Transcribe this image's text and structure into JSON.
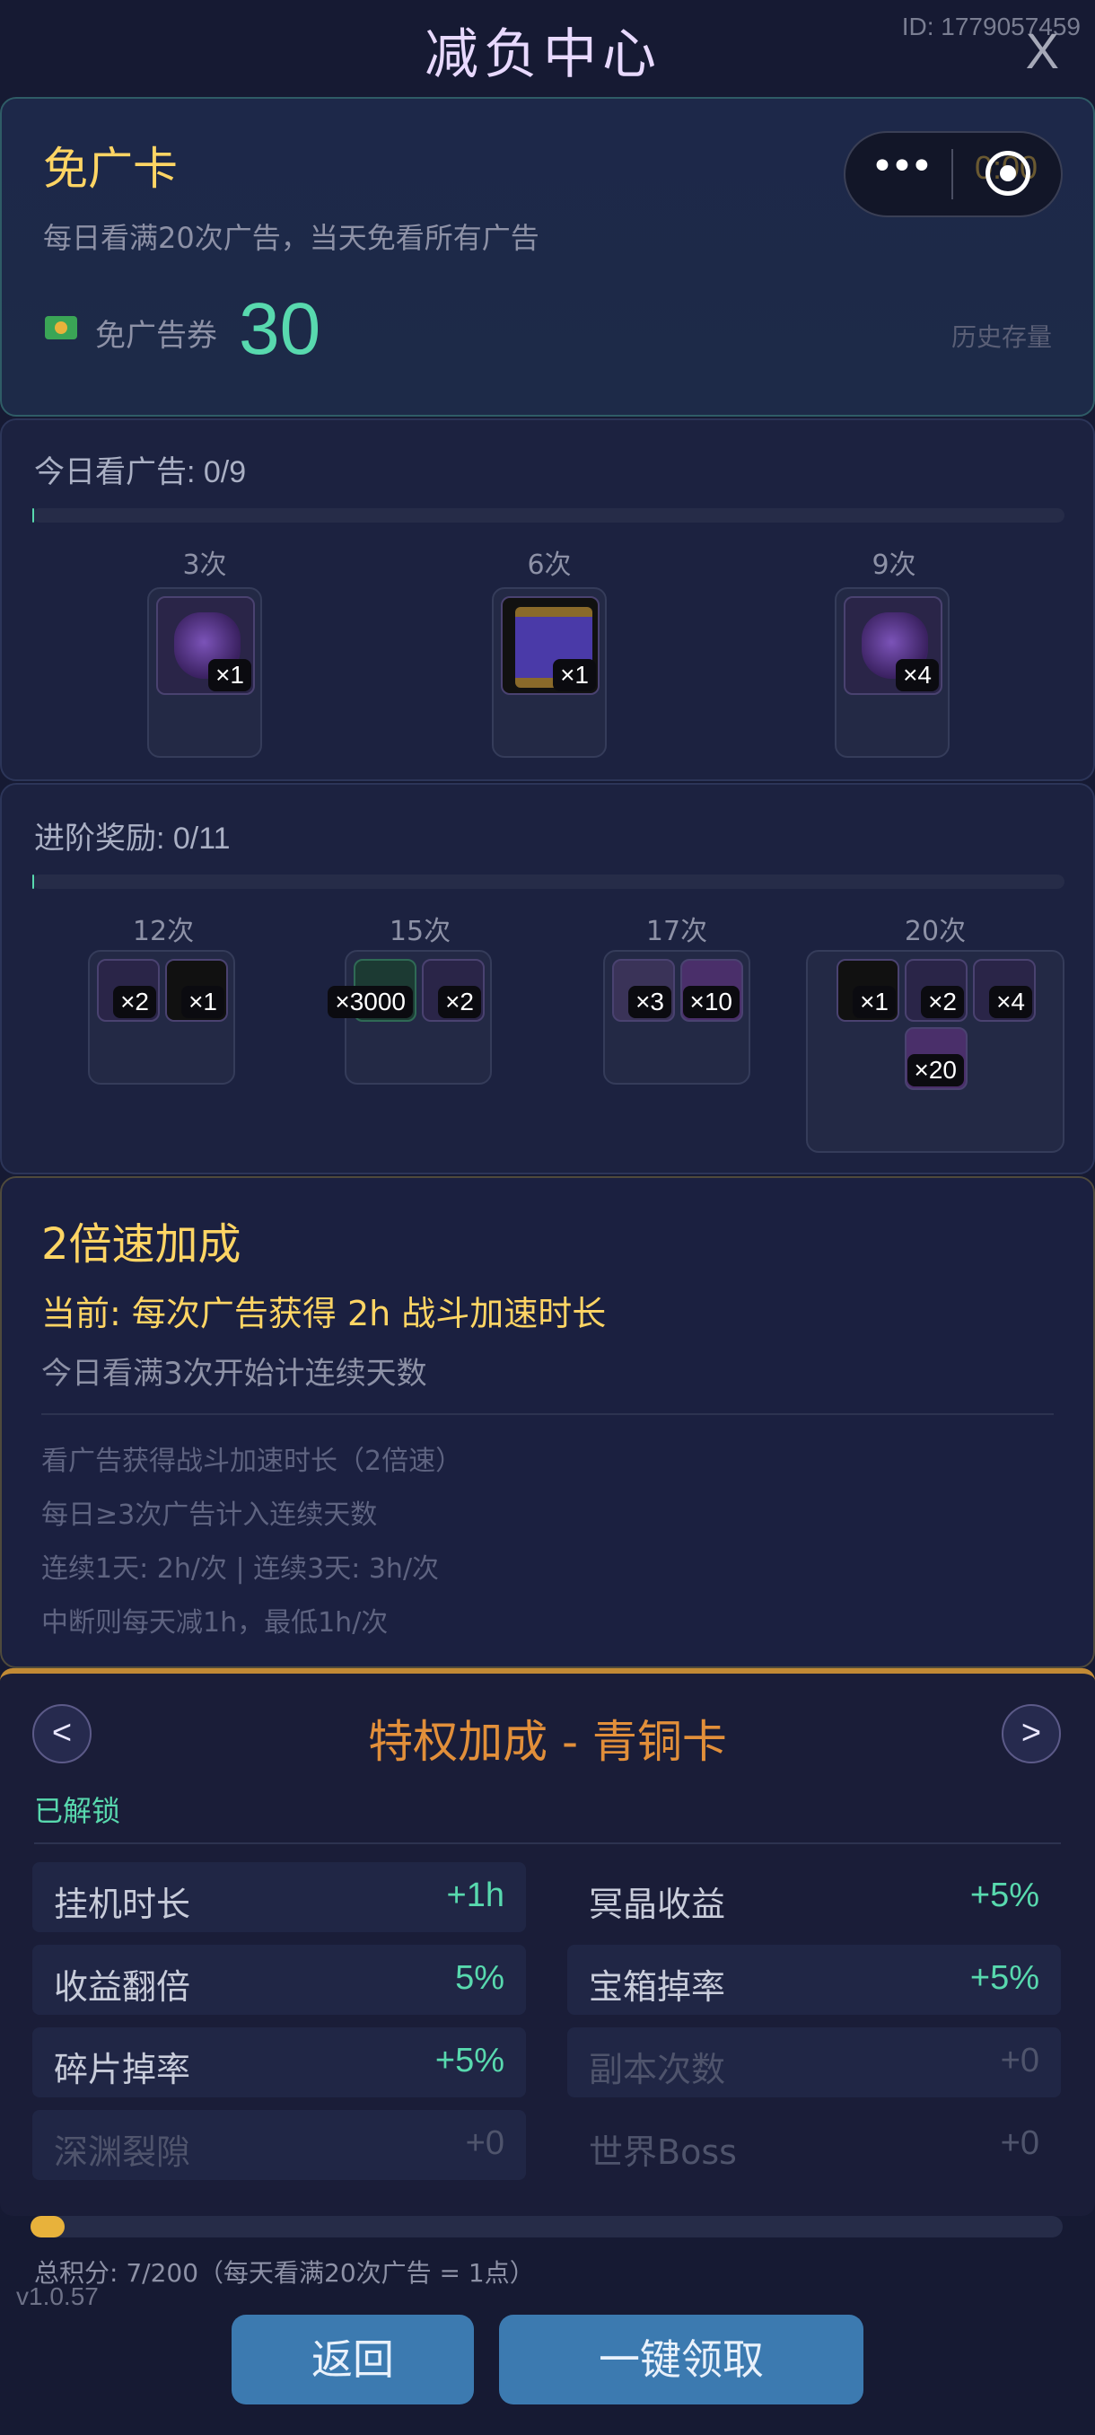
{
  "header": {
    "title": "减负中心",
    "uid": "ID: 1779057459",
    "close": "X"
  },
  "mini_program": {
    "time_overlay": "0:00"
  },
  "ad_free_card": {
    "title": "免广卡",
    "description": "每日看满20次广告，当天免看所有广告",
    "ticket_label": "免广告券",
    "ticket_count": "30",
    "history": "历史存量"
  },
  "daily_ads": {
    "label": "今日看广告: 0/9",
    "progress": 0,
    "tiers": [
      {
        "label": "3次",
        "items": [
          {
            "icon": "purple-bag-icon",
            "qty": "×1"
          }
        ]
      },
      {
        "label": "6次",
        "items": [
          {
            "icon": "scroll-icon",
            "qty": "×1"
          }
        ]
      },
      {
        "label": "9次",
        "items": [
          {
            "icon": "purple-bag-icon",
            "qty": "×4"
          }
        ]
      }
    ]
  },
  "advanced_rewards": {
    "label": "进阶奖励: 0/11",
    "progress": 0,
    "tiers": [
      {
        "label": "12次",
        "items": [
          {
            "qty": "×2"
          },
          {
            "qty": "×1"
          }
        ]
      },
      {
        "label": "15次",
        "items": [
          {
            "qty": "×3000"
          },
          {
            "qty": "×2"
          }
        ]
      },
      {
        "label": "17次",
        "items": [
          {
            "qty": "×3"
          },
          {
            "qty": "×10"
          }
        ]
      },
      {
        "label": "20次",
        "items": [
          {
            "qty": "×1"
          },
          {
            "qty": "×2"
          },
          {
            "qty": "×4"
          },
          {
            "qty": "×20"
          }
        ]
      }
    ]
  },
  "speed_boost": {
    "title": "2倍速加成",
    "current": "当前: 每次广告获得 2h 战斗加速时长",
    "subtitle": "今日看满3次开始计连续天数",
    "notes": [
      "看广告获得战斗加速时长（2倍速）",
      "每日≥3次广告计入连续天数",
      "连续1天: 2h/次 | 连续3天: 3h/次",
      "中断则每天减1h，最低1h/次"
    ]
  },
  "privilege": {
    "prev": "<",
    "next": ">",
    "title": "特权加成 - 青铜卡",
    "status": "已解锁",
    "stats": [
      {
        "name": "挂机时长",
        "value": "+1h"
      },
      {
        "name": "冥晶收益",
        "value": "+5%"
      },
      {
        "name": "收益翻倍",
        "value": "5%"
      },
      {
        "name": "宝箱掉率",
        "value": "+5%"
      },
      {
        "name": "碎片掉率",
        "value": "+5%"
      },
      {
        "name": "副本次数",
        "value": "+0"
      },
      {
        "name": "深渊裂隙",
        "value": "+0"
      },
      {
        "name": "世界Boss",
        "value": "+0"
      }
    ]
  },
  "total": {
    "label": "总积分: 7/200（每天看满20次广告 = 1点）",
    "progress": 0.035
  },
  "version": "v1.0.57",
  "buttons": {
    "back": "返回",
    "claim_all": "一键领取"
  },
  "colors": {
    "accent_gold": "#ffd564",
    "accent_green": "#58d9ae",
    "accent_orange": "#e28f3a",
    "button_blue": "#3c7ab0"
  }
}
